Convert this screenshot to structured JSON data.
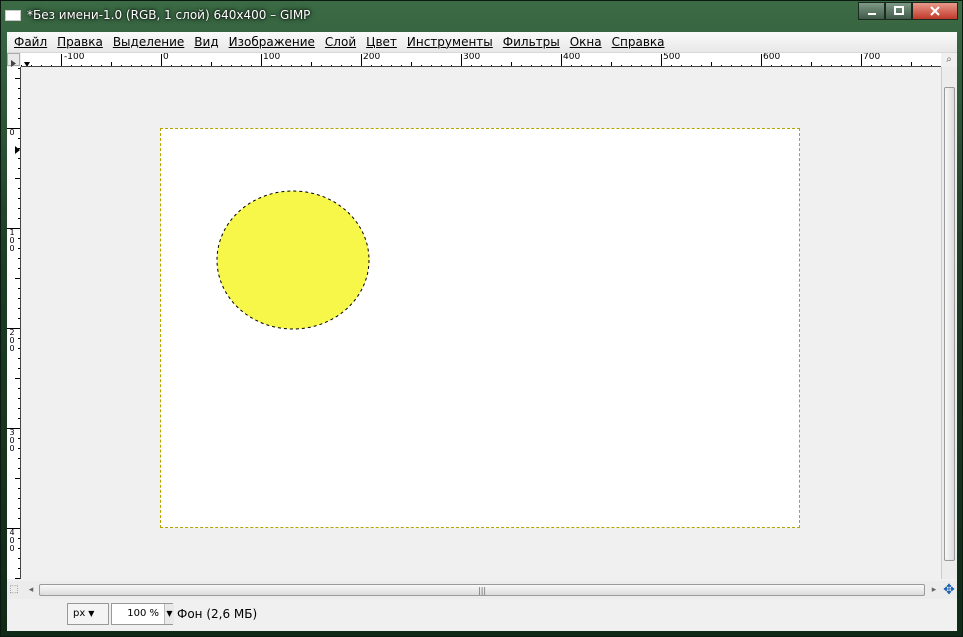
{
  "window": {
    "title": "*Без имени-1.0 (RGB, 1 слой) 640x400 – GIMP",
    "minimize_label": "minimize",
    "maximize_label": "maximize",
    "close_label": "close"
  },
  "menubar": {
    "items": [
      "Файл",
      "Правка",
      "Выделение",
      "Вид",
      "Изображение",
      "Слой",
      "Цвет",
      "Инструменты",
      "Фильтры",
      "Окна",
      "Справка"
    ]
  },
  "rulers": {
    "horizontal_labels": [
      "-100",
      "0",
      "100",
      "200",
      "300",
      "400",
      "500",
      "600",
      "700"
    ],
    "vertical_labels": [
      "0",
      "100",
      "200",
      "300",
      "400"
    ]
  },
  "canvas": {
    "image_width": 640,
    "image_height": 400,
    "background_color": "#ffffff",
    "ellipse_fill": "#f7f74a",
    "selection_color": "#000000",
    "boundary_color": "#d8c400"
  },
  "statusbar": {
    "unit": "px",
    "zoom": "100 %",
    "layer_info": "Фон (2,6 МБ)"
  },
  "icons": {
    "navigate": "navigate-icon",
    "zoom_fit": "zoom-fit-icon",
    "quick_mask": "quick-mask-icon",
    "menu_arrow": "ruler-menu-icon"
  }
}
